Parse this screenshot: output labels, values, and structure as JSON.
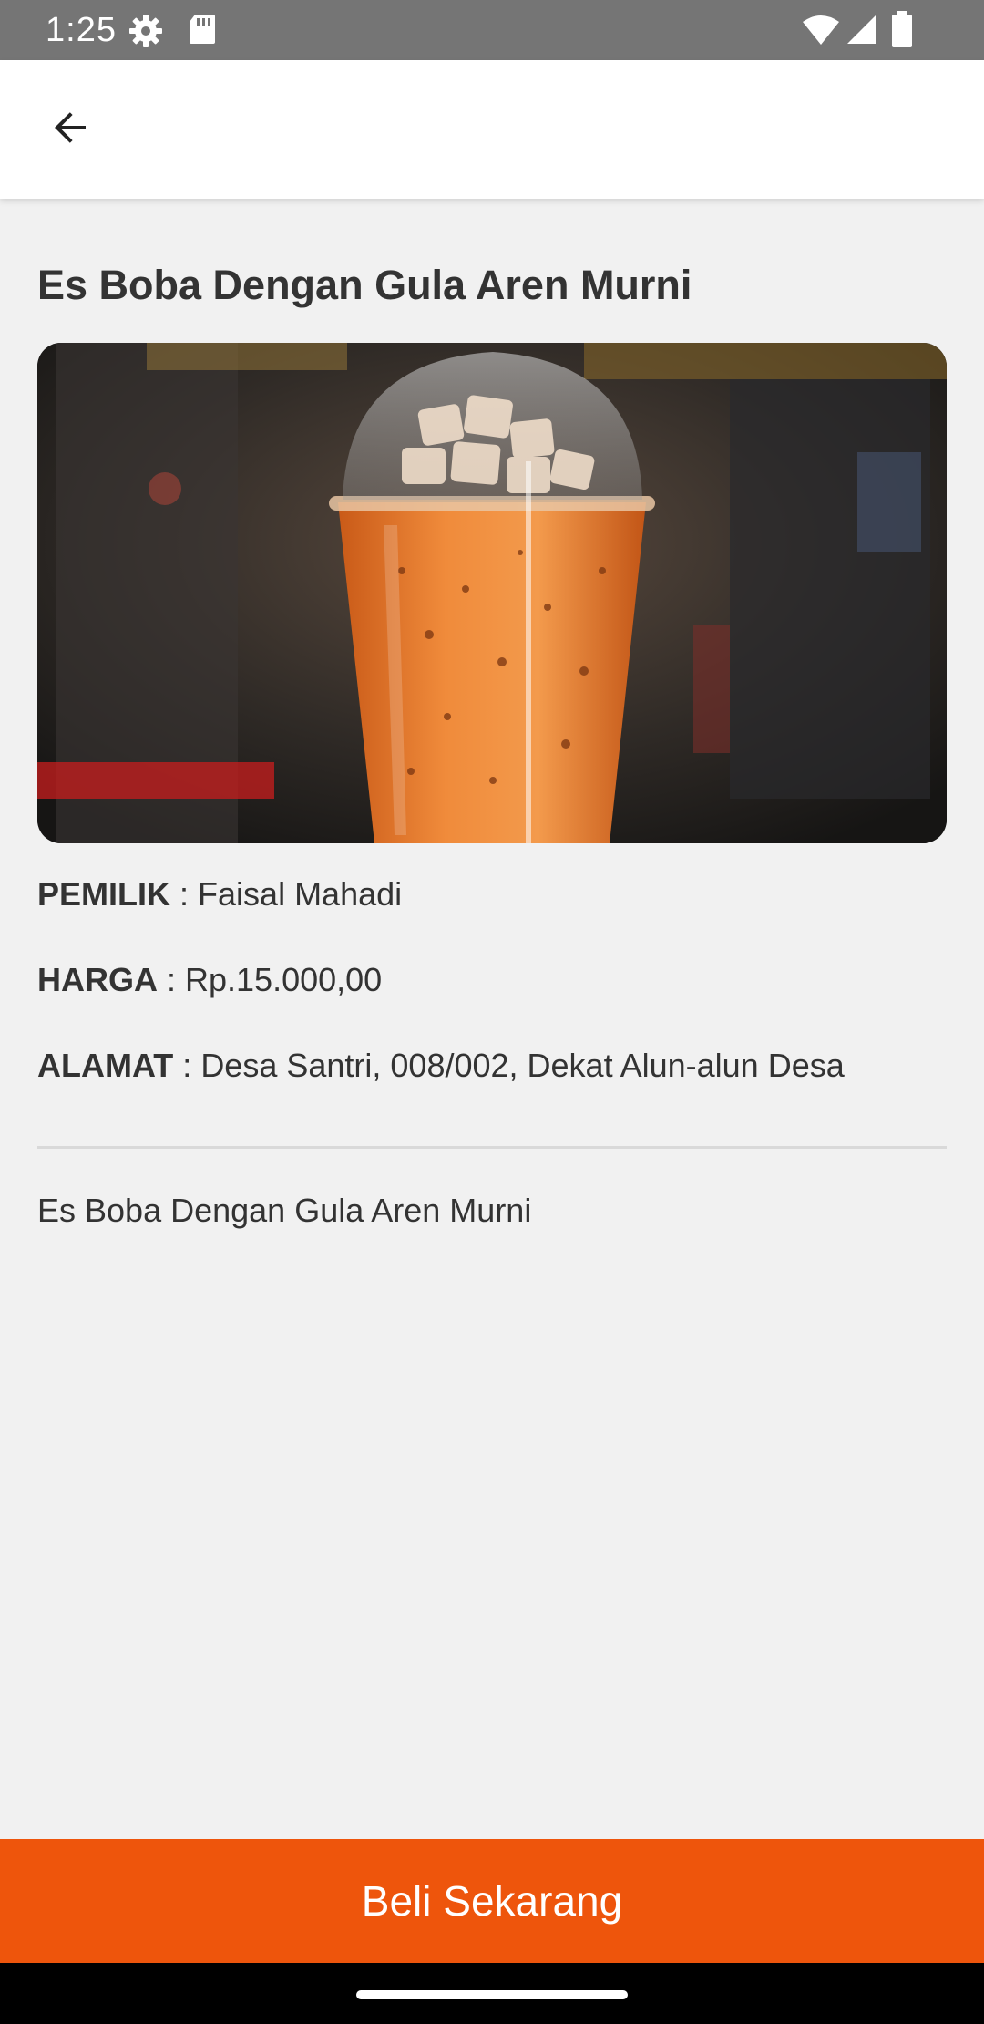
{
  "status_bar": {
    "time": "1:25",
    "icons": [
      "settings-gear-icon",
      "sd-card-icon",
      "wifi-icon",
      "signal-icon",
      "battery-icon"
    ]
  },
  "app_bar": {
    "back_icon": "arrow-back-icon"
  },
  "product": {
    "title": "Es Boba Dengan Gula Aren Murni",
    "owner_label": "PEMILIK",
    "owner_value": "Faisal Mahadi",
    "price_label": "HARGA",
    "price_value": "Rp.15.000,00",
    "address_label": "ALAMAT",
    "address_value": "Desa Santri, 008/002, Dekat Alun-alun Desa",
    "separator": " : ",
    "description": "Es Boba Dengan Gula Aren Murni"
  },
  "actions": {
    "buy_label": "Beli Sekarang"
  },
  "colors": {
    "accent": "#ee550c",
    "status_bar": "#757575",
    "background": "#f1f1f1"
  }
}
